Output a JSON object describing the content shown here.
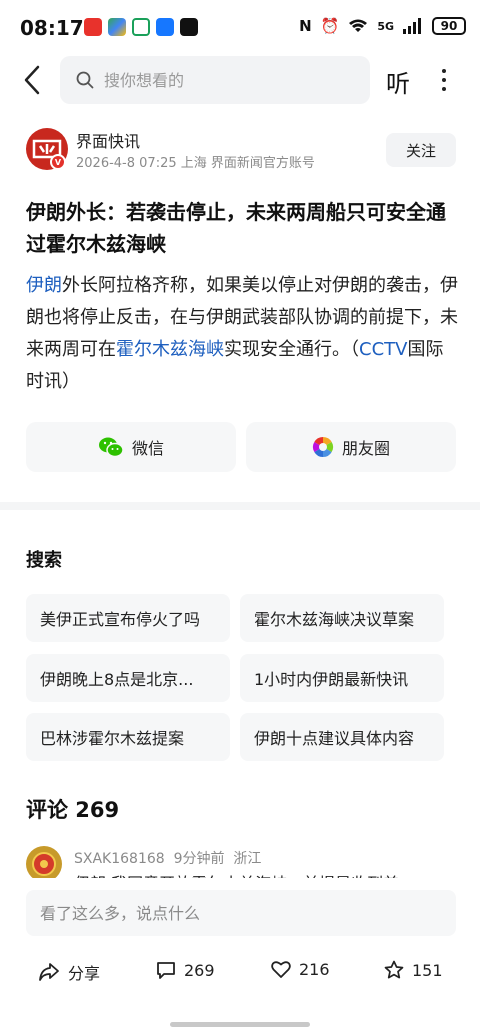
{
  "status_bar": {
    "time": "08:17",
    "battery": "90",
    "network": "5G"
  },
  "topbar": {
    "search_placeholder": "搜你想看的",
    "listen_label": "听"
  },
  "author": {
    "name": "界面快讯",
    "date": "2026-4-8",
    "time": "07:25",
    "location": "上海",
    "account_type": "界面新闻官方账号",
    "follow_label": "关注"
  },
  "article": {
    "headline": "伊朗外长：若袭击停止，未来两周船只可安全通过霍尔木兹海峡",
    "body_link1": "伊朗",
    "body_part1": "外长阿拉格齐称，如果美以停止对伊朗的袭击，伊朗也将停止反击，在与伊朗武装部队协调的前提下，未来两周可在",
    "body_link2": "霍尔木兹海峡",
    "body_part2": "实现安全通行。（",
    "body_link3": "CCTV",
    "body_part3": "国际时讯）"
  },
  "share": {
    "wechat": "微信",
    "moments": "朋友圈"
  },
  "search_section": {
    "heading": "搜索",
    "chips": [
      "美伊正式宣布停火了吗",
      "霍尔木兹海峡决议草案",
      "伊朗晚上8点是北京...",
      "1小时内伊朗最新快讯",
      "巴林涉霍尔木兹提案",
      "伊朗十点建议具体内容"
    ]
  },
  "comments": {
    "heading": "评论 269",
    "first": {
      "user": "SXAK168168",
      "time": "9分钟前",
      "location": "浙江",
      "text": "伊朗 我同意开放霍尔木兹海峡，前提是收到美"
    },
    "input_placeholder": "看了这么多，说点什么"
  },
  "actions": {
    "share_label": "分享",
    "comments_count": "269",
    "likes_count": "216",
    "favorites_count": "151"
  },
  "colors": {
    "link": "#1e5fbf",
    "brand_red": "#c8281e",
    "wechat_green": "#2dc100"
  }
}
